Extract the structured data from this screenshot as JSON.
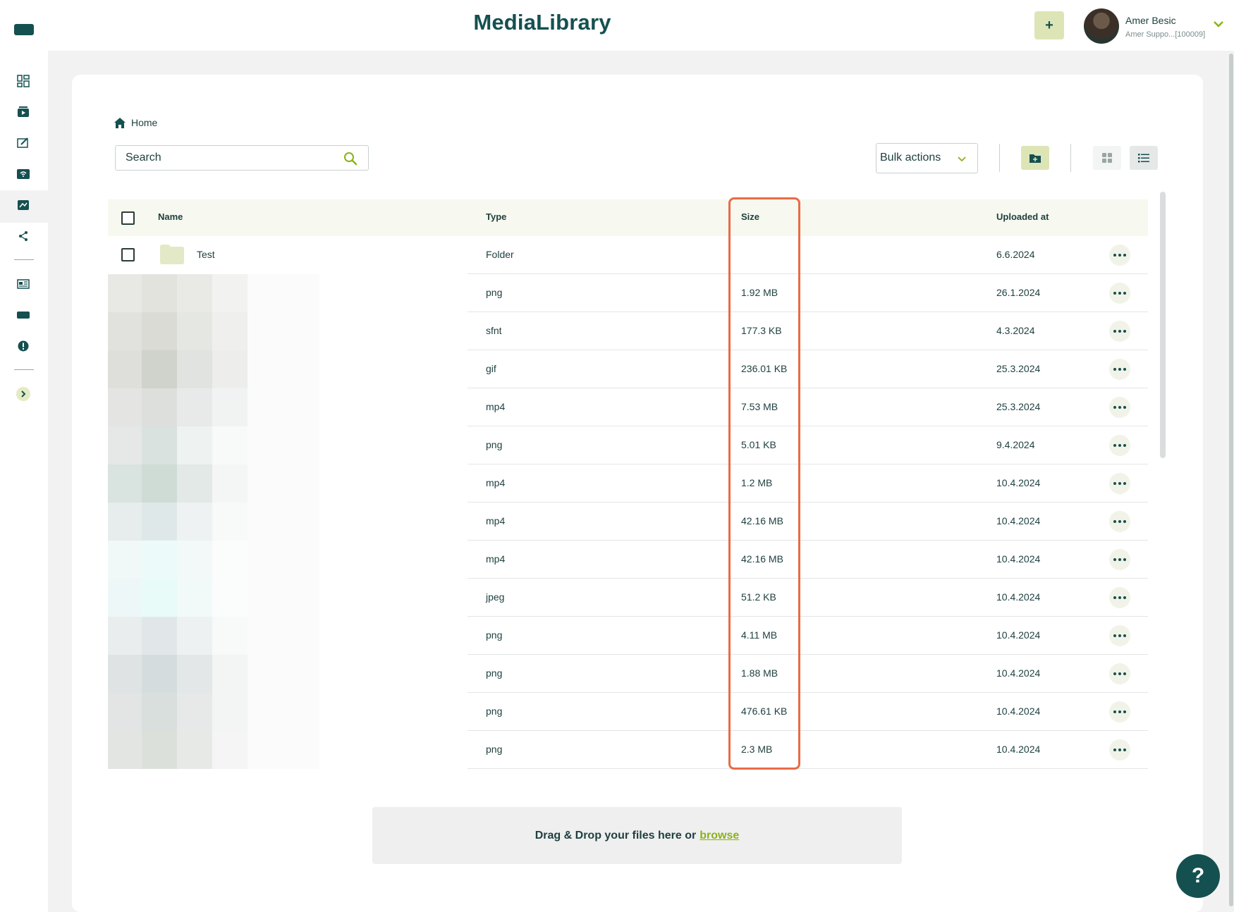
{
  "app": {
    "title": "MediaLibrary",
    "accent": "#155050",
    "highlight_color": "#ea6b45",
    "button_tint": "#dde5b6"
  },
  "header": {
    "add_label": "+",
    "user_name": "Amer Besic",
    "user_role": "Amer Suppo...[100009]"
  },
  "sidebar": {
    "items": [
      {
        "icon": "dashboard-icon"
      },
      {
        "icon": "media-player-icon"
      },
      {
        "icon": "edit-screen-icon"
      },
      {
        "icon": "broadcast-icon"
      },
      {
        "icon": "media-library-icon",
        "active": true
      },
      {
        "icon": "share-icon"
      },
      {
        "icon": "news-icon"
      },
      {
        "icon": "display-icon"
      },
      {
        "icon": "alert-icon"
      },
      {
        "icon": "expand-icon"
      }
    ]
  },
  "breadcrumb": {
    "home": "Home"
  },
  "search": {
    "placeholder": "Search"
  },
  "toolbar": {
    "bulk_actions": "Bulk actions"
  },
  "table": {
    "headers": {
      "name": "Name",
      "type": "Type",
      "size": "Size",
      "uploaded": "Uploaded at"
    },
    "rows": [
      {
        "name": "Test",
        "type": "Folder",
        "size": "",
        "uploaded": "6.6.2024",
        "kind": "folder"
      },
      {
        "name": "",
        "type": "png",
        "size": "1.92 MB",
        "uploaded": "26.1.2024",
        "kind": "file"
      },
      {
        "name": "",
        "type": "sfnt",
        "size": "177.3 KB",
        "uploaded": "4.3.2024",
        "kind": "file"
      },
      {
        "name": "",
        "type": "gif",
        "size": "236.01 KB",
        "uploaded": "25.3.2024",
        "kind": "file"
      },
      {
        "name": "",
        "type": "mp4",
        "size": "7.53 MB",
        "uploaded": "25.3.2024",
        "kind": "file"
      },
      {
        "name": "",
        "type": "png",
        "size": "5.01 KB",
        "uploaded": "9.4.2024",
        "kind": "file"
      },
      {
        "name": "",
        "type": "mp4",
        "size": "1.2 MB",
        "uploaded": "10.4.2024",
        "kind": "file"
      },
      {
        "name": "",
        "type": "mp4",
        "size": "42.16 MB",
        "uploaded": "10.4.2024",
        "kind": "file"
      },
      {
        "name": "",
        "type": "mp4",
        "size": "42.16 MB",
        "uploaded": "10.4.2024",
        "kind": "file"
      },
      {
        "name": "",
        "type": "jpeg",
        "size": "51.2 KB",
        "uploaded": "10.4.2024",
        "kind": "file"
      },
      {
        "name": "",
        "type": "png",
        "size": "4.11 MB",
        "uploaded": "10.4.2024",
        "kind": "file"
      },
      {
        "name": "",
        "type": "png",
        "size": "1.88 MB",
        "uploaded": "10.4.2024",
        "kind": "file"
      },
      {
        "name": "",
        "type": "png",
        "size": "476.61 KB",
        "uploaded": "10.4.2024",
        "kind": "file"
      },
      {
        "name": "",
        "type": "png",
        "size": "2.3 MB",
        "uploaded": "10.4.2024",
        "kind": "file"
      }
    ]
  },
  "dropzone": {
    "text": "Drag & Drop your files here or",
    "link": "browse"
  },
  "help": {
    "label": "?"
  }
}
